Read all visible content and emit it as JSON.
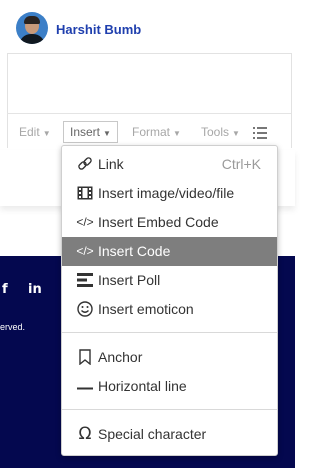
{
  "user": {
    "name": "Harshit Bumb"
  },
  "toolbar": {
    "edit": "Edit",
    "insert": "Insert",
    "format": "Format",
    "tools": "Tools"
  },
  "menu": {
    "link": {
      "label": "Link",
      "shortcut": "Ctrl+K"
    },
    "media": {
      "label": "Insert image/video/file"
    },
    "embed": {
      "label": "Insert Embed Code"
    },
    "code": {
      "label": "Insert Code"
    },
    "poll": {
      "label": "Insert Poll"
    },
    "emoticon": {
      "label": "Insert emoticon"
    },
    "anchor": {
      "label": "Anchor"
    },
    "hr": {
      "label": "Horizontal line"
    },
    "special": {
      "label": "Special character"
    }
  },
  "footer": {
    "social_facebook": "f",
    "social_linkedin": "in",
    "rights_fragment": "erved."
  },
  "colors": {
    "footer_bg": "#04084f",
    "username": "#1f3fae",
    "active_item_bg": "#7e7e7e"
  }
}
